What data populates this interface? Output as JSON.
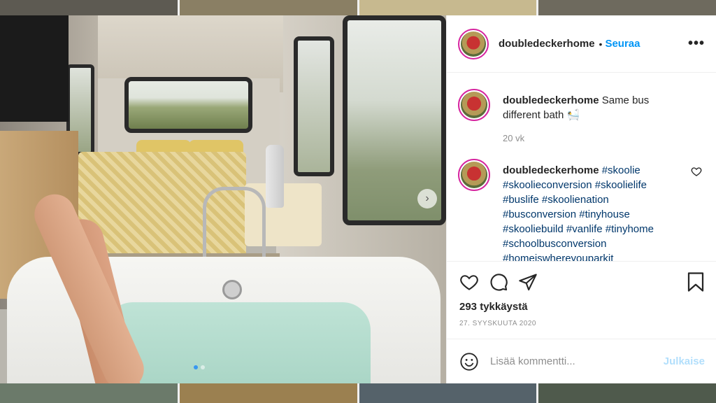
{
  "post": {
    "username": "doubledeckerhome",
    "follow_label": "Seuraa",
    "separator": "•",
    "more_label": "•••"
  },
  "comments": [
    {
      "username": "doubledeckerhome",
      "text": "Same bus different bath",
      "emoji": "🛀",
      "time": "20 vk"
    },
    {
      "username": "doubledeckerhome",
      "hashtags": "#skoolie #skoolieconversion #skoolielife #buslife #skoolienation #busconversion #tinyhouse #skooliebuild #vanlife #tinyhome #schoolbusconversion #homeiswhereyouparkit"
    }
  ],
  "likes": "293 tykkäystä",
  "date": "27. SYYSKUUTA 2020",
  "add_comment": {
    "placeholder": "Lisää kommentti...",
    "publish_label": "Julkaise"
  },
  "carousel": {
    "next_label": "›",
    "current_index": 1,
    "total": 2
  },
  "colors": {
    "accent": "#0095f6",
    "hashtag": "#00376b",
    "muted": "#8e8e8e"
  }
}
